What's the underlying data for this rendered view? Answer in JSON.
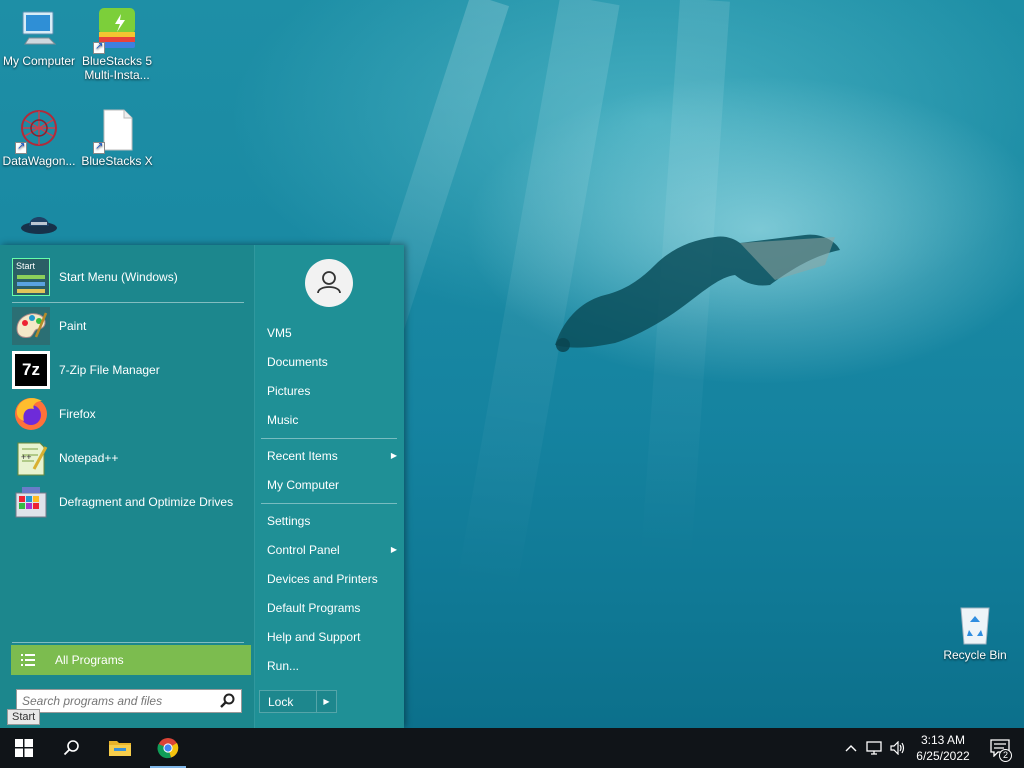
{
  "desktop": {
    "icons": [
      {
        "label": "My Computer"
      },
      {
        "label": "BlueStacks 5 Multi-Insta..."
      },
      {
        "label": "DataWagon..."
      },
      {
        "label": "BlueStacks X"
      },
      {
        "label": "Recycle Bin"
      }
    ]
  },
  "start_menu": {
    "pinned": [
      {
        "label": "Start Menu (Windows)",
        "icon": "start-menu-settings-icon"
      },
      {
        "label": "Paint",
        "icon": "paint-palette-icon"
      },
      {
        "label": "7-Zip File Manager",
        "icon": "7zip-icon"
      },
      {
        "label": "Firefox",
        "icon": "firefox-icon"
      },
      {
        "label": "Notepad++",
        "icon": "notepad-plus-plus-icon"
      },
      {
        "label": "Defragment and Optimize Drives",
        "icon": "defrag-icon"
      }
    ],
    "start_icon_text": "Start",
    "all_programs": "All Programs",
    "search_placeholder": "Search programs and files",
    "right": {
      "items": [
        {
          "label": "VM5"
        },
        {
          "label": "Documents"
        },
        {
          "label": "Pictures"
        },
        {
          "label": "Music"
        },
        {
          "label": "Recent Items",
          "submenu": true
        },
        {
          "label": "My Computer"
        },
        {
          "label": "Settings"
        },
        {
          "label": "Control Panel",
          "submenu": true
        },
        {
          "label": "Devices and Printers"
        },
        {
          "label": "Default Programs"
        },
        {
          "label": "Help and Support"
        },
        {
          "label": "Run..."
        }
      ],
      "lock_label": "Lock"
    }
  },
  "tooltip": "Start",
  "taskbar": {
    "apps": [
      "windows-start-icon",
      "search-icon",
      "file-explorer-icon",
      "chrome-icon"
    ],
    "clock_time": "3:13 AM",
    "clock_date": "6/25/2022",
    "notification_count": "2"
  },
  "colors": {
    "menu_bg": "#1c878d",
    "all_programs_bg": "#7cbc4f",
    "taskbar_bg": "#101418"
  }
}
